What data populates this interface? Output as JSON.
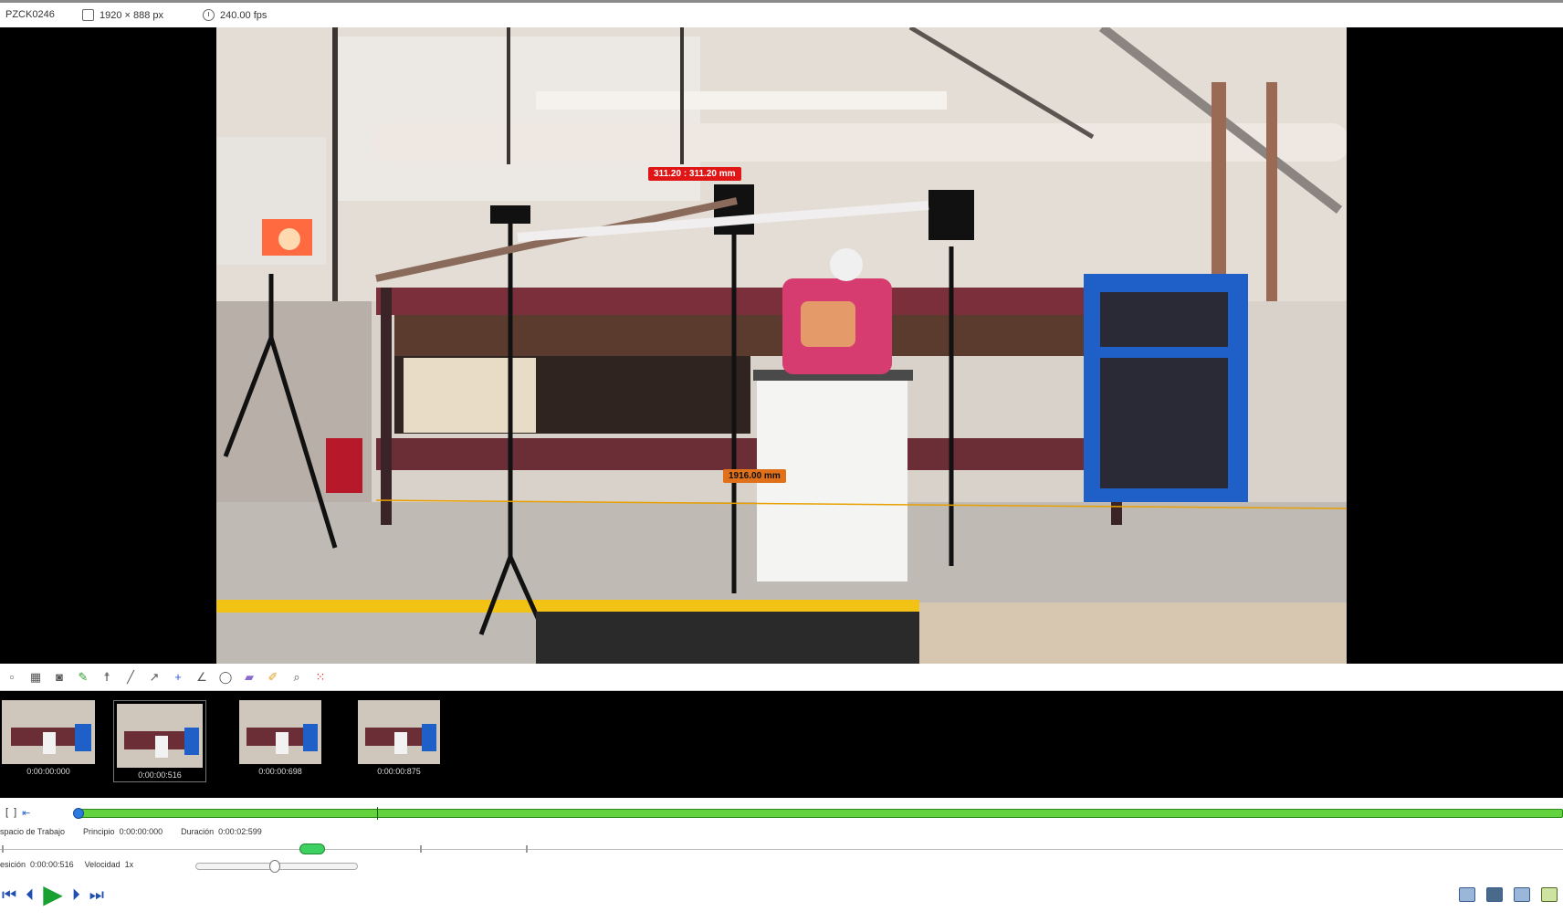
{
  "topbar": {
    "clip_name": "PZCK0246",
    "resolution": "1920 × 888 px",
    "fps": "240.00 fps"
  },
  "measurements": {
    "red_label": "311.20 : 311.20 mm",
    "orange_label": "1916.00 mm"
  },
  "toolbar": {
    "tools": [
      "new-icon",
      "grid-icon",
      "camera-icon",
      "pencil-icon",
      "pose-icon",
      "line-icon",
      "arrow-icon",
      "cross-icon",
      "angle-icon",
      "circle-icon",
      "eraser-icon",
      "marker-icon",
      "magnifier-icon",
      "dots-icon"
    ]
  },
  "thumbnails": [
    {
      "time": "0:00:00:000",
      "selected": false
    },
    {
      "time": "0:00:00:516",
      "selected": true
    },
    {
      "time": "0:00:00:698",
      "selected": false
    },
    {
      "time": "0:00:00:875",
      "selected": false
    }
  ],
  "timeline": {
    "workspace_label": "spacio de Trabajo",
    "start_label": "Principio",
    "start_value": "0:00:00:000",
    "duration_label": "Duración",
    "duration_value": "0:00:02:599",
    "position_label": "esición",
    "position_value": "0:00:00:516",
    "speed_label": "Velocidad",
    "speed_value": "1x"
  },
  "colors": {
    "timeline_green": "#62d33c",
    "play_green": "#18a030",
    "nav_blue": "#1f4fb0",
    "measure_red": "#e01515",
    "measure_orange": "#e0701a"
  }
}
